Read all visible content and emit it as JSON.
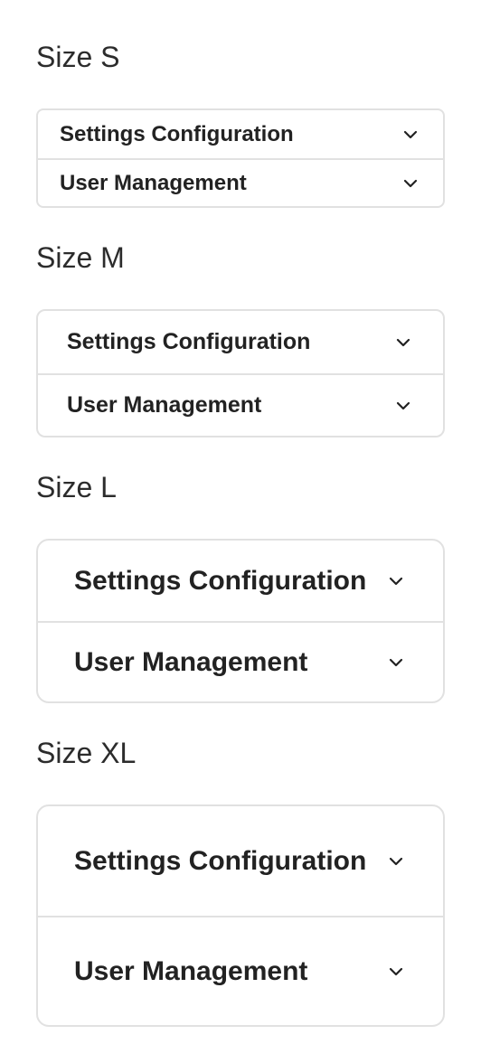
{
  "sections": [
    {
      "title": "Size S",
      "items": [
        {
          "label": "Settings Configuration",
          "icon": "chevron-down-icon"
        },
        {
          "label": "User Management",
          "icon": "chevron-down-icon"
        }
      ]
    },
    {
      "title": "Size M",
      "items": [
        {
          "label": "Settings Configuration",
          "icon": "chevron-down-icon"
        },
        {
          "label": "User Management",
          "icon": "chevron-down-icon"
        }
      ]
    },
    {
      "title": "Size L",
      "items": [
        {
          "label": "Settings Configuration",
          "icon": "chevron-down-icon"
        },
        {
          "label": "User Management",
          "icon": "chevron-down-icon"
        }
      ]
    },
    {
      "title": "Size XL",
      "items": [
        {
          "label": "Settings Configuration",
          "icon": "chevron-down-icon"
        },
        {
          "label": "User Management",
          "icon": "chevron-down-icon"
        }
      ]
    }
  ],
  "colors": {
    "border": "#e1e1e1",
    "text": "#222222",
    "heading": "#2c2c2c",
    "background": "#ffffff"
  }
}
